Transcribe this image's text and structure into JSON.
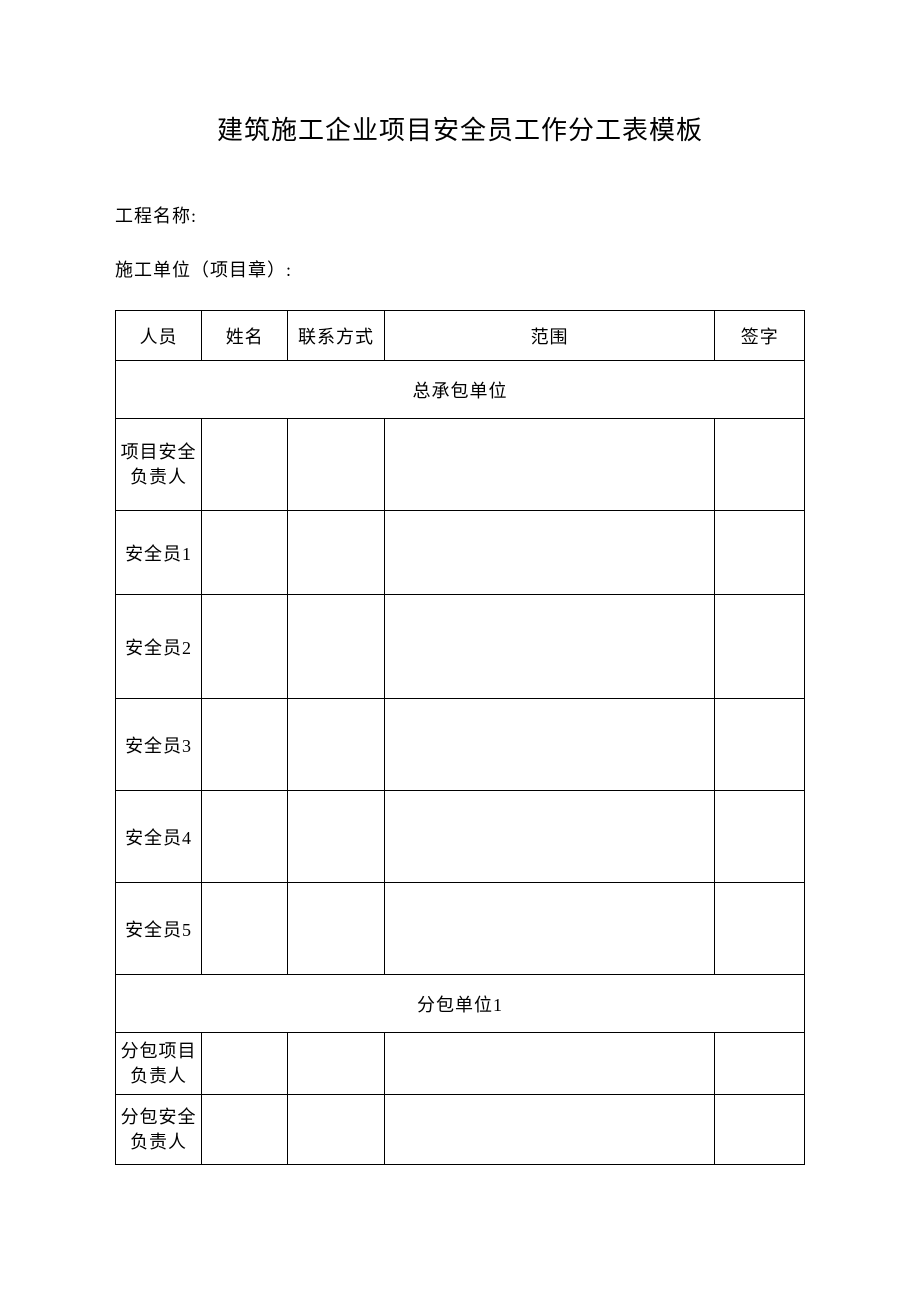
{
  "title": "建筑施工企业项目安全员工作分工表模板",
  "fields": {
    "project_name_label": "工程名称:",
    "construction_unit_label": "施工单位（项目章）:"
  },
  "headers": {
    "person": "人员",
    "name": "姓名",
    "contact": "联系方式",
    "scope": "范围",
    "sign": "签字"
  },
  "sections": {
    "general_contractor": "总承包单位",
    "subcontractor_1": "分包单位1"
  },
  "rows": {
    "safety_lead": "项目安全\n负责人",
    "safety_1": "安全员1",
    "safety_2": "安全员2",
    "safety_3": "安全员3",
    "safety_4": "安全员4",
    "safety_5": "安全员5",
    "sub_project_lead": "分包项目\n负责人",
    "sub_safety_lead": "分包安全\n负责人"
  }
}
